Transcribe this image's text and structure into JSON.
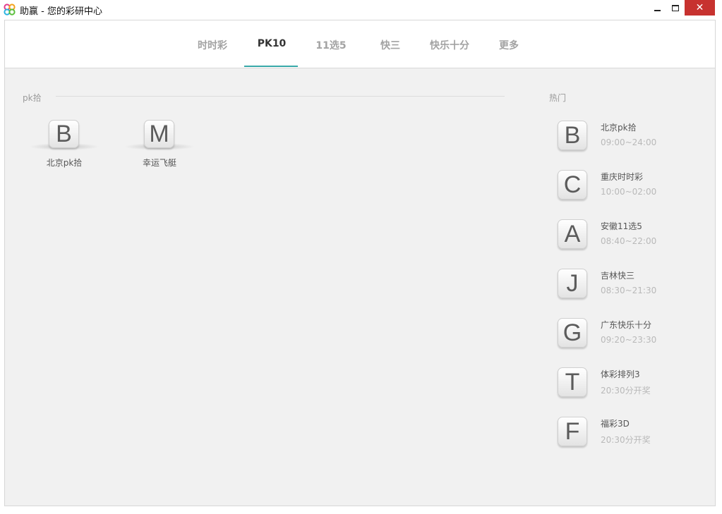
{
  "window": {
    "title": "助赢 - 您的彩研中心",
    "close_glyph": "✕"
  },
  "tabs": [
    {
      "label": "时时彩"
    },
    {
      "label": "PK10"
    },
    {
      "label": "11选5"
    },
    {
      "label": "快三"
    },
    {
      "label": "快乐十分"
    },
    {
      "label": "更多"
    }
  ],
  "active_tab": "PK10",
  "accent_color": "#37a8a8",
  "section": {
    "label": "pk拾",
    "games": [
      {
        "letter": "B",
        "name": "北京pk拾"
      },
      {
        "letter": "M",
        "name": "幸运飞艇"
      }
    ]
  },
  "hot": {
    "label": "热门",
    "items": [
      {
        "letter": "B",
        "name": "北京pk拾",
        "time": "09:00~24:00"
      },
      {
        "letter": "C",
        "name": "重庆时时彩",
        "time": "10:00~02:00"
      },
      {
        "letter": "A",
        "name": "安徽11选5",
        "time": "08:40~22:00"
      },
      {
        "letter": "J",
        "name": "吉林快三",
        "time": "08:30~21:30"
      },
      {
        "letter": "G",
        "name": "广东快乐十分",
        "time": "09:20~23:30"
      },
      {
        "letter": "T",
        "name": "体彩排列3",
        "time": "20:30分开奖"
      },
      {
        "letter": "F",
        "name": "福彩3D",
        "time": "20:30分开奖"
      }
    ]
  }
}
